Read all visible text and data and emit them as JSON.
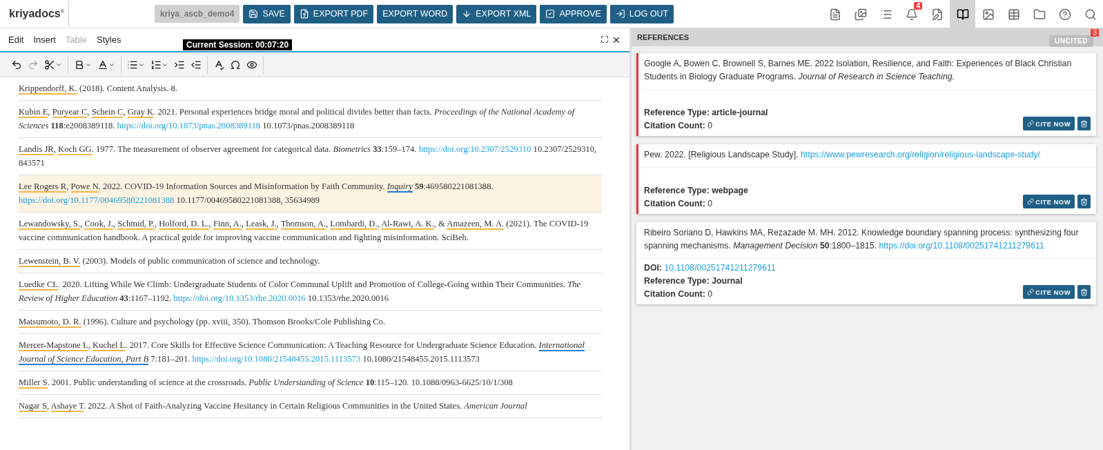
{
  "header": {
    "logo": "kriyadocs$^{®}$",
    "user": "kriya_ascb_demo4",
    "buttons": [
      {
        "label": "SAVE",
        "kind": "save"
      },
      {
        "label": "EXPORT PDF",
        "kind": "pdf"
      },
      {
        "label": "EXPORT WORD",
        "kind": "plain"
      },
      {
        "label": "EXPORT XML",
        "kind": "download"
      },
      {
        "label": "APPROVE",
        "kind": "approve"
      },
      {
        "label": "LOG OUT",
        "kind": "logout"
      }
    ],
    "tools": [
      {
        "kind": "word",
        "selected": false
      },
      {
        "kind": "pdf",
        "selected": false
      },
      {
        "kind": "list",
        "selected": false
      },
      {
        "kind": "bell",
        "selected": false,
        "badge": "4"
      },
      {
        "kind": "edit",
        "selected": false
      },
      {
        "kind": "book",
        "selected": true
      },
      {
        "kind": "image",
        "selected": false
      },
      {
        "kind": "table",
        "selected": false
      },
      {
        "kind": "folder",
        "selected": false
      },
      {
        "kind": "help",
        "selected": false
      },
      {
        "kind": "search",
        "selected": false
      }
    ]
  },
  "editor": {
    "menu": [
      {
        "label": "Edit",
        "disabled": false
      },
      {
        "label": "Insert",
        "disabled": false
      },
      {
        "label": "Table",
        "disabled": true
      },
      {
        "label": "Styles",
        "disabled": false
      }
    ],
    "session": "Current Session: 00:07:20",
    "toolbar": [
      {
        "disabled": false
      },
      {
        "disabled": true
      },
      {
        "disabled": false
      },
      {
        "disabled": false
      },
      {
        "disabled": false
      },
      {
        "disabled": false
      },
      {
        "disabled": false
      },
      {
        "disabled": false
      },
      {
        "disabled": false
      },
      {
        "disabled": false
      },
      {
        "disabled": false
      },
      {
        "disabled": false
      }
    ],
    "references": [
      {
        "selected": false,
        "segments": [
          {
            "kind": "author",
            "text": "Krippendorff, K."
          },
          {
            "kind": "text",
            "text": " (2018). Content Analysis. 8."
          }
        ]
      },
      {
        "selected": false,
        "segments": [
          {
            "kind": "author",
            "text": "Kubin E"
          },
          {
            "kind": "text",
            "text": ", "
          },
          {
            "kind": "author",
            "text": "Puryear C"
          },
          {
            "kind": "text",
            "text": ", "
          },
          {
            "kind": "author",
            "text": "Schein C"
          },
          {
            "kind": "text",
            "text": ", "
          },
          {
            "kind": "author",
            "text": "Gray K"
          },
          {
            "kind": "text",
            "text": ". 2021. Personal experiences bridge moral and political divides better than facts. *Proceedings of the National Academy of Sciences* **118**:e2008389118. "
          },
          {
            "kind": "link",
            "text": "https://doi.org/10.1073/pnas.2008389118"
          },
          {
            "kind": "text",
            "text": " 10.1073/pnas.2008389118"
          }
        ]
      },
      {
        "selected": false,
        "segments": [
          {
            "kind": "author",
            "text": "Landis JR"
          },
          {
            "kind": "text",
            "text": ", "
          },
          {
            "kind": "author",
            "text": "Koch GG"
          },
          {
            "kind": "text",
            "text": ". 1977. The measurement of observer agreement for categorical data. *Biometrics* **33**:159–174. "
          },
          {
            "kind": "link",
            "text": "https://doi.org/10.2307/2529310"
          },
          {
            "kind": "text",
            "text": " 10.2307/2529310, 843571"
          }
        ]
      },
      {
        "selected": true,
        "segments": [
          {
            "kind": "author",
            "text": "Lee Rogers R"
          },
          {
            "kind": "text",
            "text": ", "
          },
          {
            "kind": "author",
            "text": "Powe N"
          },
          {
            "kind": "text",
            "text": ". 2022. COVID-19 Information Sources and Misinformation by Faith Community. "
          },
          {
            "kind": "journal",
            "text": "Inquiry"
          },
          {
            "kind": "text",
            "text": " **59**:469580221081388. "
          },
          {
            "kind": "link",
            "text": "https://doi.org/10.1177/00469580221081388"
          },
          {
            "kind": "text",
            "text": " 10.1177/00469580221081388, 35634989"
          }
        ]
      },
      {
        "selected": false,
        "segments": [
          {
            "kind": "author",
            "text": "Lewandowsky, S."
          },
          {
            "kind": "text",
            "text": ", "
          },
          {
            "kind": "author",
            "text": "Cook, J."
          },
          {
            "kind": "text",
            "text": ", "
          },
          {
            "kind": "author",
            "text": "Schmid, P."
          },
          {
            "kind": "text",
            "text": ", "
          },
          {
            "kind": "author",
            "text": "Holford, D. L."
          },
          {
            "kind": "text",
            "text": ", "
          },
          {
            "kind": "author",
            "text": "Finn, A."
          },
          {
            "kind": "text",
            "text": ", "
          },
          {
            "kind": "author",
            "text": "Leask, J."
          },
          {
            "kind": "text",
            "text": ", "
          },
          {
            "kind": "author",
            "text": "Thomson, A."
          },
          {
            "kind": "text",
            "text": ", "
          },
          {
            "kind": "author",
            "text": "Lombardi, D."
          },
          {
            "kind": "text",
            "text": ", "
          },
          {
            "kind": "author",
            "text": "Al-Rawi, A. K."
          },
          {
            "kind": "text",
            "text": ", & "
          },
          {
            "kind": "author",
            "text": "Amazeen, M. A."
          },
          {
            "kind": "text",
            "text": " (2021). The COVID-19 vaccine communication handbook. A practical guide for improving vaccine communication and fighting misinformation. SciBeh."
          }
        ]
      },
      {
        "selected": false,
        "segments": [
          {
            "kind": "author",
            "text": "Lewenstein, B. V."
          },
          {
            "kind": "text",
            "text": " (2003). Models of public communication of science and technology."
          }
        ]
      },
      {
        "selected": false,
        "segments": [
          {
            "kind": "author",
            "text": "Luedke CL"
          },
          {
            "kind": "text",
            "text": ". 2020. Lifting While We Climb: Undergraduate Students of Color Communal Uplift and Promotion of College-Going within Their Communities. *The Review of Higher Education* **43**:1167–1192. "
          },
          {
            "kind": "link",
            "text": "https://doi.org/10.1353/rhe.2020.0016"
          },
          {
            "kind": "text",
            "text": " 10.1353/rhe.2020.0016"
          }
        ]
      },
      {
        "selected": false,
        "segments": [
          {
            "kind": "author",
            "text": "Matsumoto, D. R."
          },
          {
            "kind": "text",
            "text": " (1996). Culture and psychology (pp. xviii, 350). Thomson Brooks/Cole Publishing Co."
          }
        ]
      },
      {
        "selected": false,
        "segments": [
          {
            "kind": "author",
            "text": "Mercer-Mapstone L"
          },
          {
            "kind": "text",
            "text": ", "
          },
          {
            "kind": "author",
            "text": "Kuchel L"
          },
          {
            "kind": "text",
            "text": ". 2017. Core Skills for Effective Science Communication: A Teaching Resource for Undergraduate Science Education. "
          },
          {
            "kind": "journal",
            "text": "International Journal of Science Education, Part B"
          },
          {
            "kind": "text",
            "text": " 7:181–201. "
          },
          {
            "kind": "link",
            "text": "https://doi.org/10.1080/21548455.2015.1113573"
          },
          {
            "kind": "text",
            "text": " 10.1080/21548455.2015.1113573"
          }
        ]
      },
      {
        "selected": false,
        "segments": [
          {
            "kind": "author",
            "text": "Miller S"
          },
          {
            "kind": "text",
            "text": ". 2001. Public understanding of science at the crossroads. *Public Understanding of Science* **10**:115–120. 10.1088/0963-6625/10/1/308"
          }
        ]
      },
      {
        "selected": false,
        "segments": [
          {
            "kind": "author",
            "text": "Nagar S"
          },
          {
            "kind": "text",
            "text": ", "
          },
          {
            "kind": "author",
            "text": "Ashaye T"
          },
          {
            "kind": "text",
            "text": ". 2022. A Shot of Faith-Analyzing Vaccine Hesitancy in Certain Religious Communities in the United States. *American Journal*"
          }
        ]
      }
    ]
  },
  "panel": {
    "title": "REFERENCES",
    "filter": {
      "label": "UNCITED",
      "count": "3"
    },
    "cards": [
      {
        "uncited": true,
        "segments": [
          {
            "kind": "text",
            "text": "Google A, Bowen C, Brownell S, Barnes ME. 2022 Isolation, Resilience, and Faith: Experiences of Black Christian Students in Biology Graduate Programs. *Journal of Research in Science Teaching.*"
          }
        ],
        "fields": [
          {
            "kind": "bold",
            "label": "Reference Type:",
            "value": "article-journal"
          },
          {
            "kind": "plain",
            "label": "Citation Count:",
            "value": "0"
          }
        ],
        "cite": "CITE NOW"
      },
      {
        "uncited": true,
        "segments": [
          {
            "kind": "text",
            "text": "Pew. 2022. [Religious Landscape Study]. "
          },
          {
            "kind": "link",
            "text": "https://www.pewresearch.org/religion/religious-landscape-study/"
          }
        ],
        "fields": [
          {
            "kind": "bold",
            "label": "Reference Type:",
            "value": "webpage"
          },
          {
            "kind": "plain",
            "label": "Citation Count:",
            "value": "0"
          }
        ],
        "cite": "CITE NOW"
      },
      {
        "uncited": false,
        "segments": [
          {
            "kind": "text",
            "text": "Ribeiro Soriano D, Hawkins MA, Rezazade M. MH. 2012. Knowledge boundary spanning process: synthesizing four spanning mechanisms. *Management Decision* **50**:1800–1815. "
          },
          {
            "kind": "link",
            "text": "https://doi.org/10.1108/00251741211279611"
          }
        ],
        "fields": [
          {
            "kind": "link",
            "label": "DOI:",
            "value": "10.1108/00251741211279611"
          },
          {
            "kind": "bold",
            "label": "Reference Type:",
            "value": "Journal"
          },
          {
            "kind": "plain",
            "label": "Citation Count:",
            "value": "0"
          }
        ],
        "cite": "CITE NOW"
      }
    ]
  }
}
